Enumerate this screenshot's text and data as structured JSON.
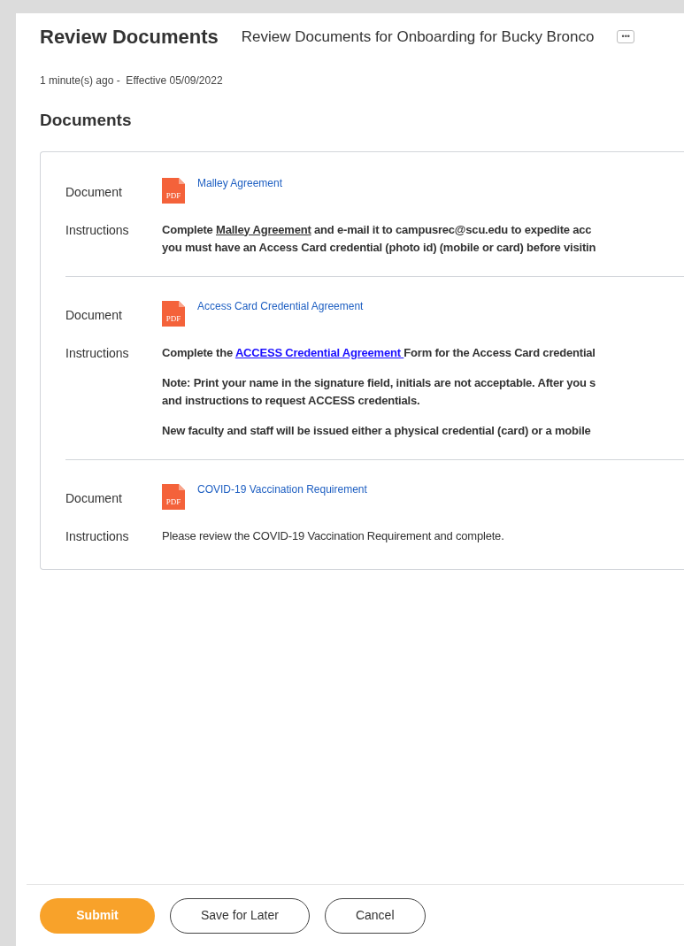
{
  "header": {
    "title": "Review Documents",
    "subtitle": "Review Documents for Onboarding for Bucky Bronco",
    "more": "•••"
  },
  "meta": "1 minute(s) ago -  Effective 05/09/2022",
  "section_title": "Documents",
  "documents": [
    {
      "document_label": "Document",
      "file_badge": "PDF",
      "file_name": "Malley Agreement",
      "instructions_label": "Instructions",
      "bold": true,
      "paragraphs": [
        [
          [
            {
              "kind": "plain",
              "text": "Complete "
            },
            {
              "kind": "underline",
              "text": "Malley Agreement"
            },
            {
              "kind": "plain",
              "text": " and e-mail it to campusrec@scu.edu to expedite acc"
            }
          ],
          [
            {
              "kind": "plain",
              "text": "you must have an Access Card credential (photo id) (mobile or card) before visitin"
            }
          ]
        ]
      ]
    },
    {
      "document_label": "Document",
      "file_badge": "PDF",
      "file_name": "Access Card Credential Agreement",
      "instructions_label": "Instructions",
      "bold": true,
      "paragraphs": [
        [
          [
            {
              "kind": "plain",
              "text": "Complete the "
            },
            {
              "kind": "link",
              "text": "ACCESS Credential Agreement "
            },
            {
              "kind": "plain",
              "text": "Form for the Access Card credential"
            }
          ]
        ],
        [
          [
            {
              "kind": "plain",
              "text": "Note: Print your name in the signature field, initials are not acceptable. After you s"
            }
          ],
          [
            {
              "kind": "plain",
              "text": "and instructions to request ACCESS credentials."
            }
          ]
        ],
        [
          [
            {
              "kind": "plain",
              "text": "New faculty and staff will be issued either a physical credential (card) or a mobile"
            }
          ]
        ]
      ]
    },
    {
      "document_label": "Document",
      "file_badge": "PDF",
      "file_name": "COVID-19 Vaccination Requirement",
      "instructions_label": "Instructions",
      "bold": false,
      "paragraphs": [
        [
          [
            {
              "kind": "plain",
              "text": "Please review the COVID-19 Vaccination Requirement and complete."
            }
          ]
        ]
      ]
    }
  ],
  "buttons": [
    {
      "label": "Submit",
      "kind": "primary"
    },
    {
      "label": "Save for Later",
      "kind": "secondary"
    },
    {
      "label": "Cancel",
      "kind": "secondary"
    }
  ]
}
